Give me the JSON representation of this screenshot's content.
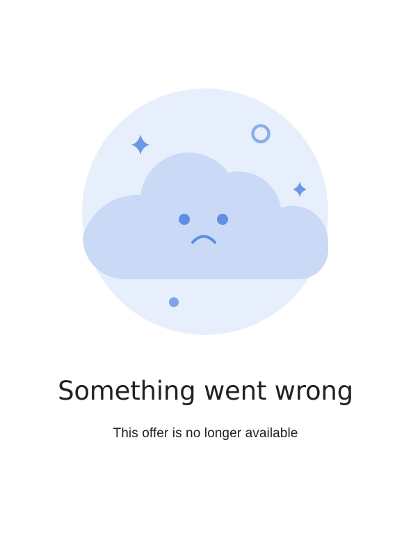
{
  "error": {
    "title": "Something went wrong",
    "message": "This offer is no longer available"
  },
  "illustration": {
    "icon": "sad-cloud-icon",
    "colors": {
      "background_circle": "#e8effc",
      "cloud": "#c9d9f6",
      "accent": "#6b97e6",
      "face": "#5f8ee2"
    }
  }
}
